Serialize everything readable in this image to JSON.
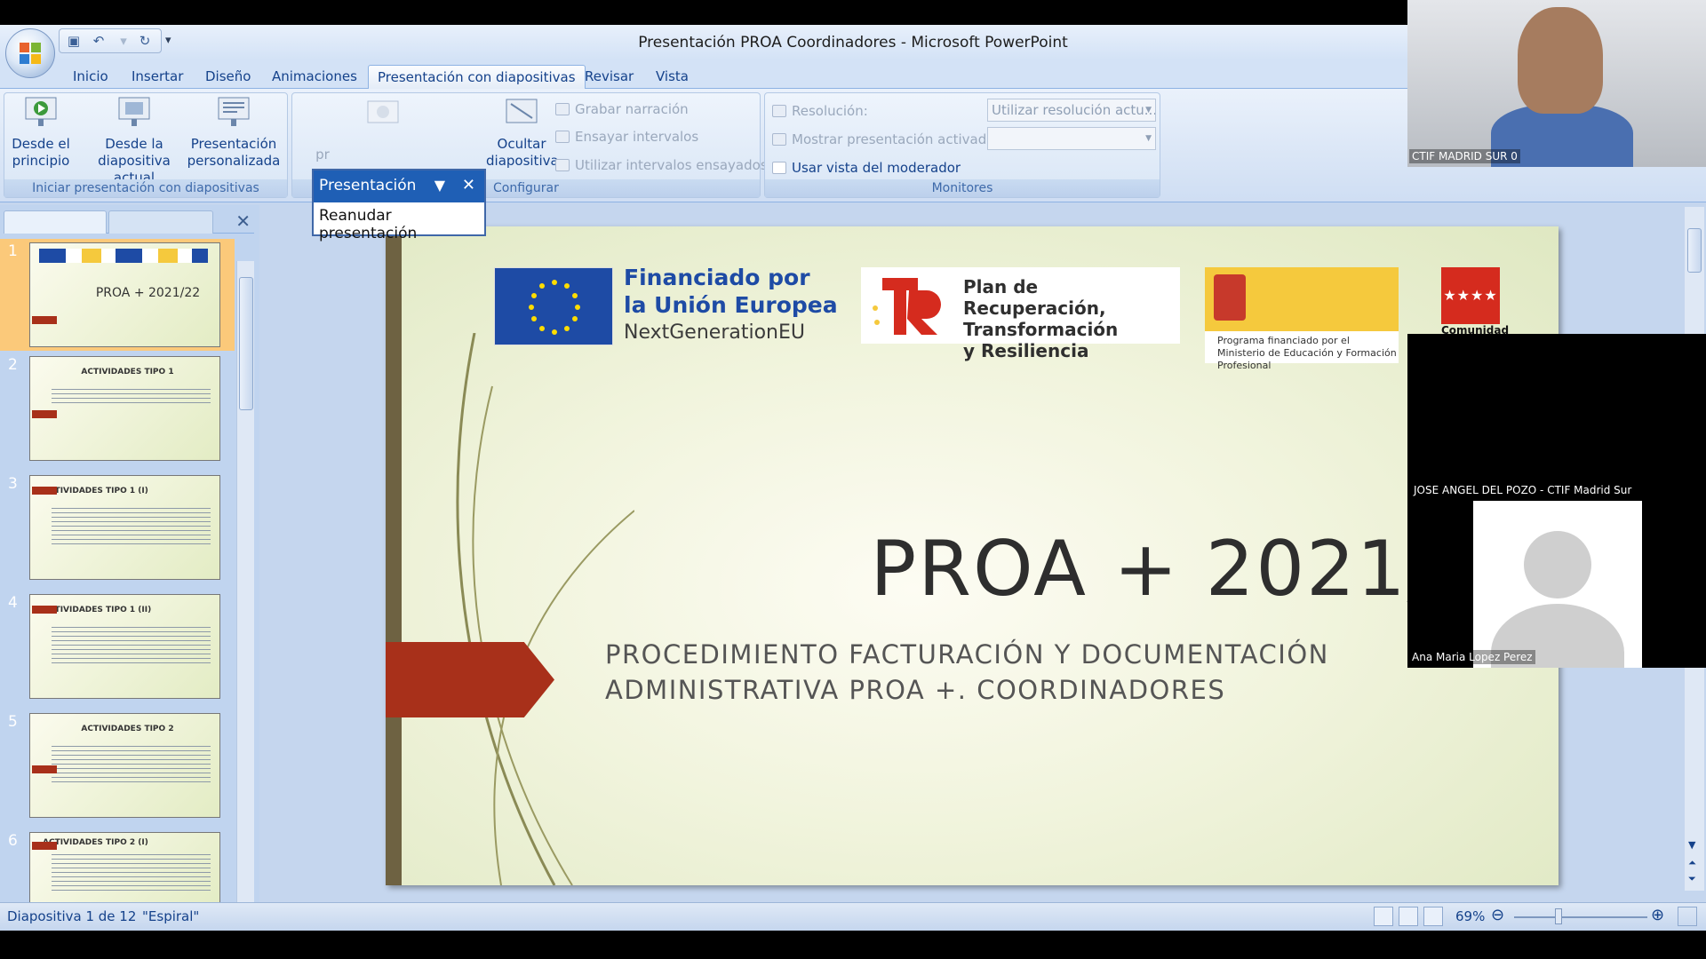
{
  "window": {
    "title": "Presentación PROA Coordinadores - Microsoft PowerPoint"
  },
  "ribbon_tabs": [
    {
      "label": "Inicio"
    },
    {
      "label": "Insertar"
    },
    {
      "label": "Diseño"
    },
    {
      "label": "Animaciones"
    },
    {
      "label": "Presentación con diapositivas"
    },
    {
      "label": "Revisar"
    },
    {
      "label": "Vista"
    }
  ],
  "groups": {
    "start": {
      "label": "Iniciar presentación con diapositivas",
      "from_start": "Desde el principio",
      "from_current": "Desde la diapositiva actual",
      "custom": "Presentación personalizada"
    },
    "configure": {
      "label": "Configurar",
      "setup_partial": "pr",
      "hide_slide": "Ocultar diapositiva",
      "record": "Grabar narración",
      "rehearse": "Ensayar intervalos",
      "use_timings": "Utilizar intervalos ensayados"
    },
    "monitors": {
      "label": "Monitores",
      "resolution_label": "Resolución:",
      "resolution_value": "Utilizar resolución actu...",
      "show_on_label": "Mostrar presentación activada:",
      "presenter_view": "Usar vista del moderador"
    }
  },
  "popup": {
    "title": "Presentación",
    "item": "Reanudar presentación"
  },
  "thumbnails": [
    {
      "num": "1",
      "title": "PROA + 2021/22"
    },
    {
      "num": "2",
      "title": "ACTIVIDADES TIPO 1"
    },
    {
      "num": "3",
      "title": "ACTIVIDADES TIPO 1 (I)"
    },
    {
      "num": "4",
      "title": "ACTIVIDADES TIPO 1 (II)"
    },
    {
      "num": "5",
      "title": "ACTIVIDADES TIPO 2"
    },
    {
      "num": "6",
      "title": "ACTIVIDADES TIPO 2 (I)"
    }
  ],
  "slide": {
    "eu_line1": "Financiado por",
    "eu_line2": "la Unión Europea",
    "eu_line3": "NextGenerationEU",
    "prtr_line1": "Plan de Recuperación,",
    "prtr_line2": "Transformación",
    "prtr_line3": "y Resiliencia",
    "gob_text": "Programa financiado por el Ministerio de Educación y Formación Profesional",
    "madrid_label": "Comunidad",
    "title": "PROA + 2021/22",
    "subtitle_line1": "PROCEDIMIENTO FACTURACIÓN Y DOCUMENTACIÓN",
    "subtitle_line2": "ADMINISTRATIVA PROA +. COORDINADORES"
  },
  "status": {
    "slide": "Diapositiva 1 de 12",
    "theme": "\"Espiral\"",
    "zoom": "69%"
  },
  "video": {
    "cam1_label": "CTIF MADRID SUR 0",
    "cam2_label": "JOSE ANGEL DEL POZO - CTIF Madrid Sur",
    "cam3_label": "Ana Maria Lopez Perez"
  },
  "colors": {
    "accent": "#a8301a",
    "eu_blue": "#1e4ba5",
    "ribbon": "#d3e2f6"
  }
}
